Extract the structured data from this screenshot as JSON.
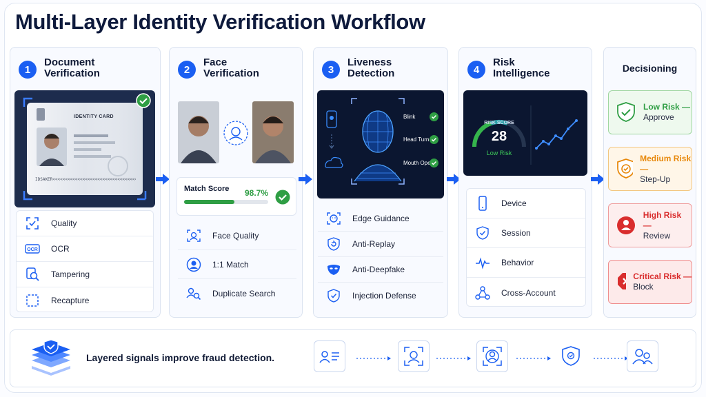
{
  "title": "Multi-Layer Identity Verification Workflow",
  "stages": [
    {
      "num": "1",
      "line1": "Document",
      "line2": "Verification",
      "card_label": "IDENTITY CARD",
      "mrz": "IDSAKER<<<<<<<<<<<<<<<<<<<<<<<<<<<<<<<<<<<<<<<<<<<<",
      "items": [
        "Quality",
        "OCR",
        "Tampering",
        "Recapture"
      ],
      "ocr_badge": "OCR"
    },
    {
      "num": "2",
      "line1": "Face",
      "line2": "Verification",
      "match_label": "Match Score",
      "match_value": "98.7%",
      "match_progress": 0.6,
      "items": [
        "Face Quality",
        "1:1 Match",
        "Duplicate Search"
      ]
    },
    {
      "num": "3",
      "line1": "Liveness",
      "line2": "Detection",
      "checks": [
        "Blink",
        "Head Turn",
        "Mouth Open"
      ],
      "items": [
        "Edge Guidance",
        "Anti-Replay",
        "Anti-Deepfake",
        "Injection Defense"
      ]
    },
    {
      "num": "4",
      "line1": "Risk",
      "line2": "Intelligence",
      "risk_label": "RISK SCORE",
      "risk_value": "28",
      "risk_level": "Low Risk",
      "items": [
        "Device",
        "Session",
        "Behavior",
        "Cross-Account"
      ]
    }
  ],
  "decisioning": {
    "title": "Decisioning",
    "outcomes": [
      {
        "level": "Low Risk —",
        "action": "Approve",
        "color": "#2f9e44"
      },
      {
        "level": "Medium Risk —",
        "action": "Step-Up",
        "color": "#e8890c"
      },
      {
        "level": "High Risk —",
        "action": "Review",
        "color": "#d92d2d"
      },
      {
        "level": "Critical Risk —",
        "action": "Block",
        "color": "#d92d2d"
      }
    ]
  },
  "footer": {
    "text": "Layered signals improve fraud detection."
  },
  "colors": {
    "accent": "#1b5ff2",
    "success": "#2f9e44",
    "dark_panel": "#0b1630"
  }
}
